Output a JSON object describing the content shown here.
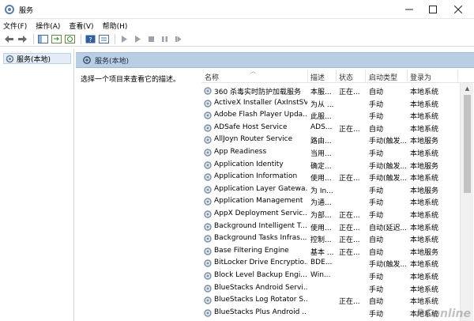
{
  "window": {
    "title": "服务"
  },
  "menu": [
    "文件(F)",
    "操作(A)",
    "查看(V)",
    "帮助(H)"
  ],
  "toolbar": {
    "buttons": [
      "back-arrow-icon",
      "forward-arrow-icon",
      "show-hide-tree-icon",
      "export-list-icon",
      "refresh-icon",
      "help-icon",
      "properties-icon",
      "start-service-icon",
      "start-service-alt-icon",
      "stop-service-icon",
      "pause-service-icon",
      "restart-service-icon"
    ]
  },
  "tree": {
    "root_label": "服务(本地)"
  },
  "panel": {
    "header": "服务(本地)",
    "description_hint": "选择一个项目来查看它的描述。"
  },
  "columns": {
    "name": "名称",
    "desc": "描述",
    "status": "状态",
    "startup": "启动类型",
    "logon": "登录为"
  },
  "services": [
    {
      "name": "360 杀毒实时防护加载服务",
      "desc": "本服...",
      "status": "正在...",
      "startup": "自动",
      "logon": "本地系统"
    },
    {
      "name": "ActiveX Installer (AxInstSV)",
      "desc": "为从 ...",
      "status": "",
      "startup": "手动",
      "logon": "本地系统"
    },
    {
      "name": "Adobe Flash Player Upda...",
      "desc": "此服...",
      "status": "",
      "startup": "手动",
      "logon": "本地系统"
    },
    {
      "name": "ADSafe Host Service",
      "desc": "ADS...",
      "status": "正在...",
      "startup": "自动",
      "logon": "本地系统"
    },
    {
      "name": "AllJoyn Router Service",
      "desc": "路由...",
      "status": "",
      "startup": "手动(触发...",
      "logon": "本地服务"
    },
    {
      "name": "App Readiness",
      "desc": "当用...",
      "status": "",
      "startup": "手动",
      "logon": "本地系统"
    },
    {
      "name": "Application Identity",
      "desc": "确定...",
      "status": "",
      "startup": "手动(触发...",
      "logon": "本地服务"
    },
    {
      "name": "Application Information",
      "desc": "使用...",
      "status": "正在...",
      "startup": "手动(触发...",
      "logon": "本地系统"
    },
    {
      "name": "Application Layer Gatewa...",
      "desc": "为 In...",
      "status": "",
      "startup": "手动",
      "logon": "本地服务"
    },
    {
      "name": "Application Management",
      "desc": "为通...",
      "status": "",
      "startup": "手动",
      "logon": "本地系统"
    },
    {
      "name": "AppX Deployment Servic...",
      "desc": "为部...",
      "status": "正在...",
      "startup": "手动",
      "logon": "本地系统"
    },
    {
      "name": "Background Intelligent T...",
      "desc": "使用...",
      "status": "正在...",
      "startup": "自动(延迟...",
      "logon": "本地系统"
    },
    {
      "name": "Background Tasks Infras...",
      "desc": "控制...",
      "status": "正在...",
      "startup": "自动",
      "logon": "本地系统"
    },
    {
      "name": "Base Filtering Engine",
      "desc": "基本 ...",
      "status": "正在...",
      "startup": "自动",
      "logon": "本地服务"
    },
    {
      "name": "BitLocker Drive Encryptio...",
      "desc": "BDE...",
      "status": "",
      "startup": "手动(触发...",
      "logon": "本地系统"
    },
    {
      "name": "Block Level Backup Engi...",
      "desc": "Win...",
      "status": "",
      "startup": "手动",
      "logon": "本地系统"
    },
    {
      "name": "BlueStacks Android Servi...",
      "desc": "",
      "status": "",
      "startup": "手动",
      "logon": "本地系统"
    },
    {
      "name": "BlueStacks Log Rotator S...",
      "desc": "",
      "status": "正在...",
      "startup": "自动",
      "logon": "本地系统"
    },
    {
      "name": "BlueStacks Plus Android ...",
      "desc": "",
      "status": "",
      "startup": "手动",
      "logon": "本地系统"
    }
  ],
  "watermark": "PConline",
  "colors": {
    "panel_header": "#b9cde3",
    "tree_selected": "#e3ecf7"
  }
}
